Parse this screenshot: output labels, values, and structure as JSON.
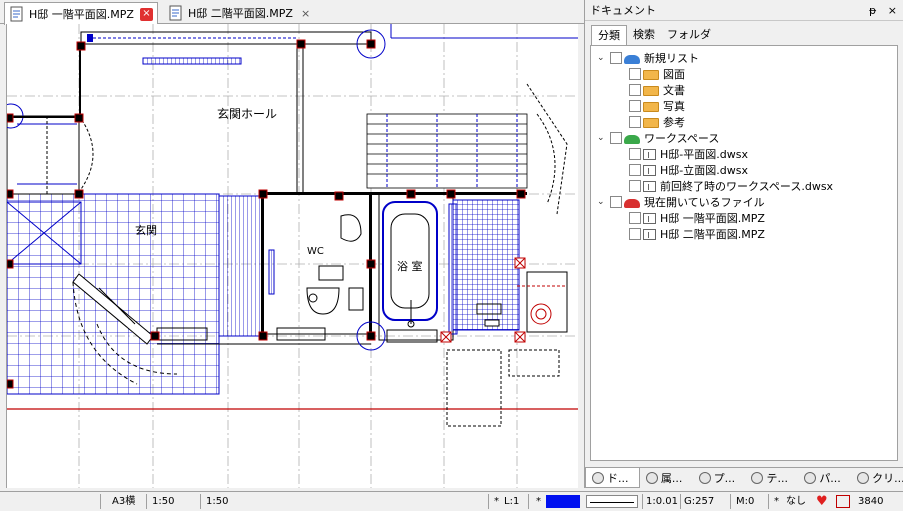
{
  "tabs": [
    {
      "label": "H邸 一階平面図.MPZ",
      "active": true
    },
    {
      "label": "H邸 二階平面図.MPZ",
      "active": false
    }
  ],
  "drawing": {
    "rooms": [
      "玄関ホール",
      "玄関",
      "WC",
      "浴 室"
    ]
  },
  "panel": {
    "title": "ドキュメント",
    "pin": "ᵽ",
    "close": "×",
    "tabs": [
      "分類",
      "検索",
      "フォルダ"
    ],
    "tree": {
      "new_list": {
        "label": "新規リスト",
        "children": [
          "図面",
          "文書",
          "写真",
          "参考"
        ]
      },
      "workspace": {
        "label": "ワークスペース",
        "children": [
          "H邸-平面図.dwsx",
          "H邸-立面図.dwsx",
          "前回終了時のワークスペース.dwsx"
        ]
      },
      "open_files": {
        "label": "現在開いているファイル",
        "children": [
          "H邸 一階平面図.MPZ",
          "H邸 二階平面図.MPZ"
        ]
      }
    },
    "bottom_tabs": [
      "ド...",
      "属...",
      "プ...",
      "テ...",
      "パ...",
      "クリ..."
    ]
  },
  "status": {
    "paper": "A3横",
    "scale1": "1:50",
    "scale2": "1:50",
    "star1": "*",
    "layer": "L:1",
    "star2": "*",
    "ratio": "1:0.01",
    "g": "G:257",
    "m": "M:0",
    "star3": "*",
    "none": "なし",
    "count": "3840"
  },
  "colors": {
    "plan_blue": "#0000c8",
    "column_red": "#c00000",
    "swatch_blue": "#0010f0"
  }
}
